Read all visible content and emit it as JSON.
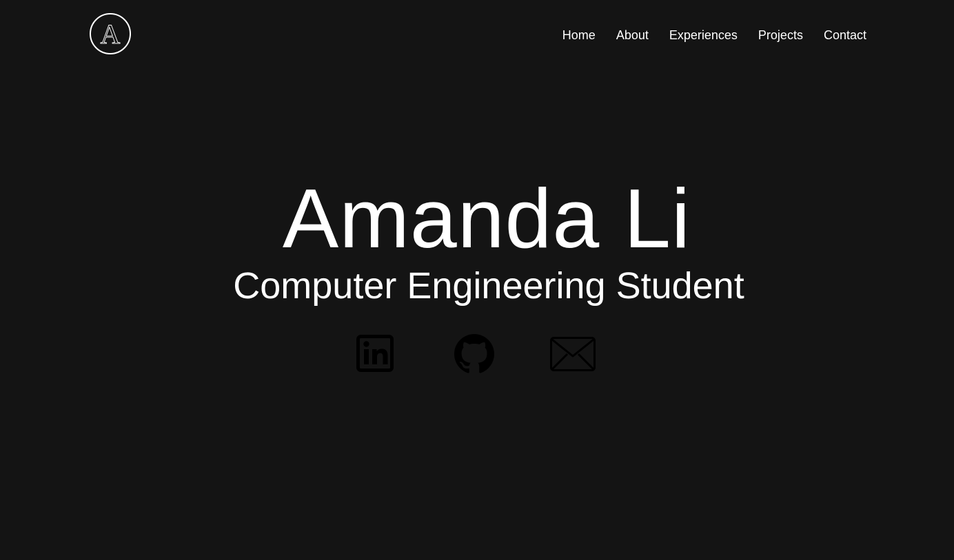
{
  "header": {
    "logo_letter": "A",
    "nav": [
      {
        "label": "Home"
      },
      {
        "label": "About"
      },
      {
        "label": "Experiences"
      },
      {
        "label": "Projects"
      },
      {
        "label": "Contact"
      }
    ]
  },
  "hero": {
    "name": "Amanda Li",
    "subtitle": "Computer Engineering Student"
  },
  "socials": [
    {
      "icon": "linkedin-icon"
    },
    {
      "icon": "github-icon"
    },
    {
      "icon": "mail-icon"
    }
  ],
  "colors": {
    "background": "#141414",
    "text": "#ffffff",
    "icon": "#000000"
  }
}
